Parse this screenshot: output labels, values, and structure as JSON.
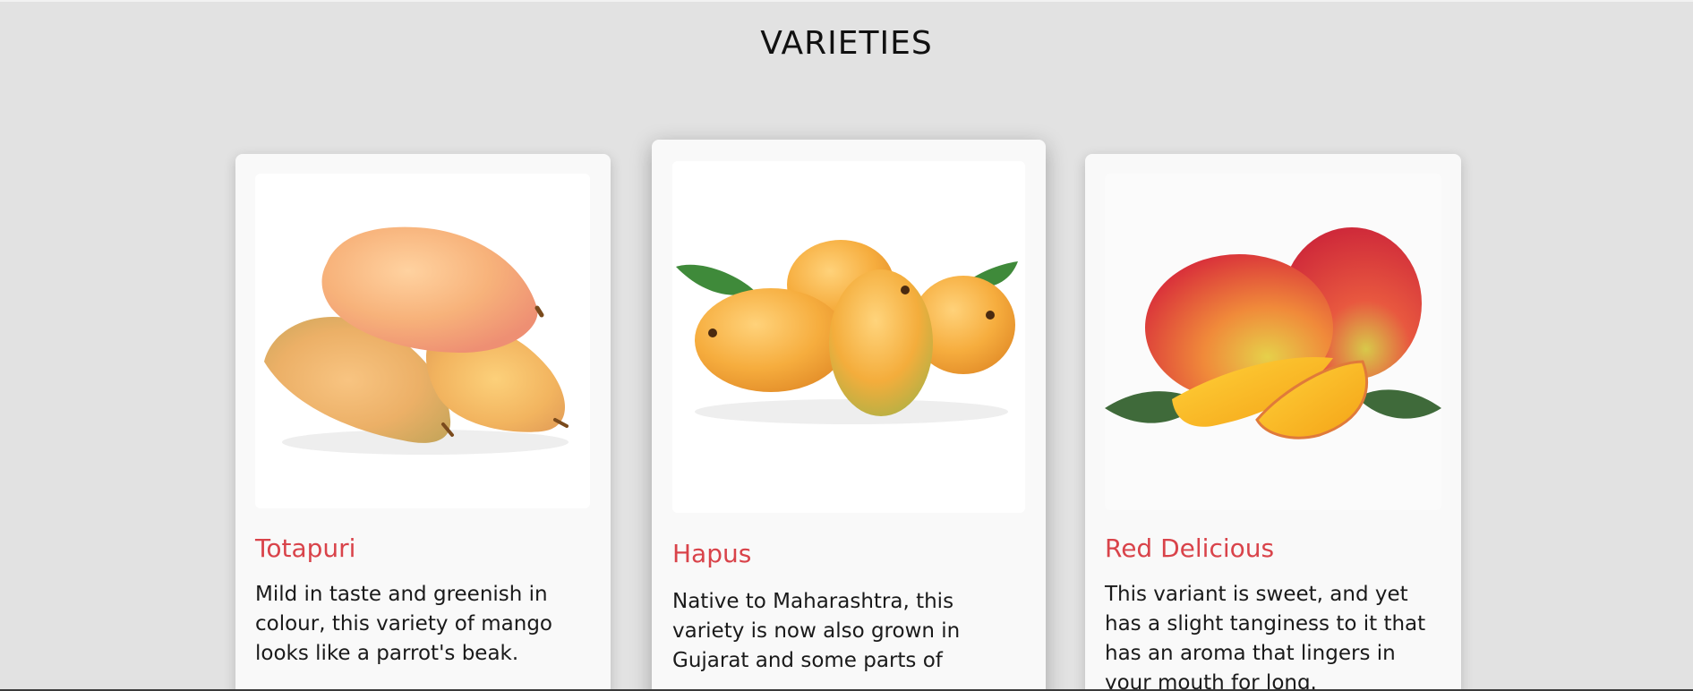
{
  "section": {
    "title": "VARIETIES"
  },
  "cards": [
    {
      "name": "Totapuri",
      "description": "Mild in taste and greenish in colour, this variety of mango looks like a parrot's beak.",
      "image_icon": "totapuri-mango-image"
    },
    {
      "name": "Hapus",
      "description": "Native to Maharashtra, this variety is now also grown in Gujarat and some parts of",
      "image_icon": "hapus-mango-image"
    },
    {
      "name": "Red Delicious",
      "description": "This variant is sweet, and yet has a slight tanginess to it that has an aroma that lingers in your mouth for long.",
      "image_icon": "red-delicious-mango-image"
    }
  ],
  "colors": {
    "background": "#e2e2e2",
    "card": "#f9f9f9",
    "accent": "#d9434a",
    "text": "#1a1a1a"
  }
}
